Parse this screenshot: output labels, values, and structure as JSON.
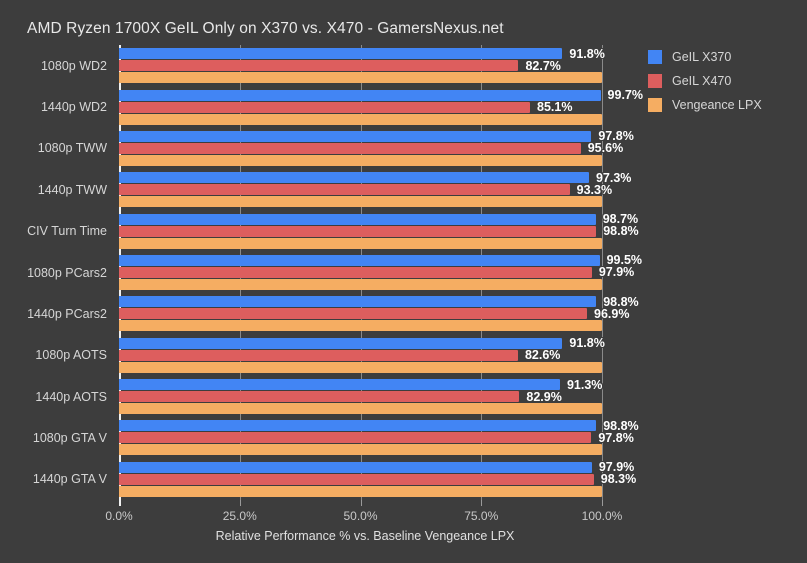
{
  "chart_data": {
    "type": "bar",
    "orientation": "horizontal",
    "title": "AMD Ryzen 1700X GeIL Only on X370 vs. X470 - GamersNexus.net",
    "xlabel": "Relative Performance % vs. Baseline Vengeance LPX",
    "ylabel": "",
    "xlim": [
      0,
      100
    ],
    "xtick_labels": [
      "0.0%",
      "25.0%",
      "50.0%",
      "75.0%",
      "100.0%"
    ],
    "xtick_values": [
      0,
      25,
      50,
      75,
      100
    ],
    "grid": true,
    "legend_position": "right",
    "categories": [
      "1080p WD2",
      "1440p WD2",
      "1080p TWW",
      "1440p TWW",
      "CIV Turn Time",
      "1080p PCars2",
      "1440p PCars2",
      "1080p AOTS",
      "1440p AOTS",
      "1080p GTA V",
      "1440p GTA V"
    ],
    "series": [
      {
        "name": "GeIL X370",
        "color": "#4285f4",
        "values": [
          91.8,
          99.7,
          97.8,
          97.3,
          98.7,
          99.5,
          98.8,
          91.8,
          91.3,
          98.8,
          97.9
        ],
        "labels": [
          "91.8%",
          "99.7%",
          "97.8%",
          "97.3%",
          "98.7%",
          "99.5%",
          "98.8%",
          "91.8%",
          "91.3%",
          "98.8%",
          "97.9%"
        ]
      },
      {
        "name": "GeIL X470",
        "color": "#dd5e5e",
        "values": [
          82.7,
          85.1,
          95.6,
          93.3,
          98.8,
          97.9,
          96.9,
          82.6,
          82.9,
          97.8,
          98.3
        ],
        "labels": [
          "82.7%",
          "85.1%",
          "95.6%",
          "93.3%",
          "98.8%",
          "97.9%",
          "96.9%",
          "82.6%",
          "82.9%",
          "97.8%",
          "98.3%"
        ]
      },
      {
        "name": "Vengeance LPX",
        "color": "#f5ad62",
        "values": [
          100,
          100,
          100,
          100,
          100,
          100,
          100,
          100,
          100,
          100,
          100
        ],
        "labels": [
          "",
          "",
          "",
          "",
          "",
          "",
          "",
          "",
          "",
          "",
          ""
        ]
      }
    ],
    "background_color": "#3d3d3d",
    "text_color": "#e8e8e8"
  }
}
